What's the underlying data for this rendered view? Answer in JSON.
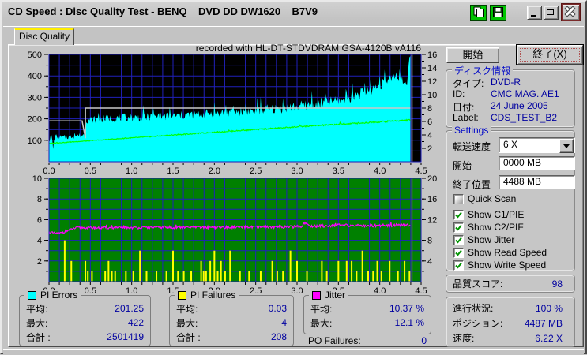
{
  "window": {
    "title": "CD Speed : Disc Quality Test - BENQ    DVD DD DW1620    B7V9"
  },
  "tab": {
    "label": "Disc Quality"
  },
  "chart_data": [
    {
      "type": "area",
      "title": "recorded with HL-DT-STDVDRAM GSA-4120B vA116",
      "x_axis": {
        "min": 0,
        "max": 4.5,
        "minor_step": 0.125,
        "ticks": [
          [
            0,
            "0.0"
          ],
          [
            0.5,
            "0.5"
          ],
          [
            1,
            "1.0"
          ],
          [
            1.5,
            "1.5"
          ],
          [
            2,
            "2.0"
          ],
          [
            2.5,
            "2.5"
          ],
          [
            3,
            "3.0"
          ],
          [
            3.5,
            "3.5"
          ],
          [
            4,
            "4.0"
          ],
          [
            4.5,
            "4.5"
          ]
        ]
      },
      "y_left": {
        "min": 0,
        "max": 500,
        "grid_step": 50,
        "ticks": [
          [
            500,
            "500"
          ],
          [
            400,
            "400"
          ],
          [
            300,
            "300"
          ],
          [
            200,
            "200"
          ],
          [
            100,
            "100"
          ]
        ]
      },
      "y_right": {
        "min": 0,
        "max": 16,
        "minor_step": 1,
        "ticks": [
          [
            16,
            "16"
          ],
          [
            14,
            "14"
          ],
          [
            12,
            "12"
          ],
          [
            10,
            "10"
          ],
          [
            8,
            "8"
          ],
          [
            6,
            "6"
          ],
          [
            4,
            "4"
          ],
          [
            2,
            "2"
          ]
        ]
      },
      "bg": "#000000",
      "grid_color": "#2121bb",
      "border_color": "#1a1ab8",
      "data_end_x": 4.37,
      "end_line_color": "#c0c0c0",
      "series": [
        {
          "name": "PI Errors",
          "type": "noisy_area",
          "color": "#00ffff",
          "axis": "left",
          "seed": 7,
          "trend": [
            [
              0,
              95
            ],
            [
              0.03,
              120
            ],
            [
              0.05,
              60
            ],
            [
              0.07,
              115
            ],
            [
              0.15,
              110
            ],
            [
              0.25,
              112
            ],
            [
              0.35,
              118
            ],
            [
              0.43,
              122
            ],
            [
              0.45,
              190
            ],
            [
              0.55,
              192
            ],
            [
              0.7,
              196
            ],
            [
              0.9,
              200
            ],
            [
              1.1,
              200
            ],
            [
              1.3,
              203
            ],
            [
              1.5,
              206
            ],
            [
              1.7,
              212
            ],
            [
              1.9,
              218
            ],
            [
              2.1,
              222
            ],
            [
              2.3,
              228
            ],
            [
              2.5,
              232
            ],
            [
              2.7,
              238
            ],
            [
              2.9,
              244
            ],
            [
              3.05,
              252
            ],
            [
              3.2,
              262
            ],
            [
              3.35,
              268
            ],
            [
              3.5,
              278
            ],
            [
              3.6,
              290
            ],
            [
              3.7,
              302
            ],
            [
              3.8,
              312
            ],
            [
              3.9,
              330
            ],
            [
              4.0,
              345
            ],
            [
              4.08,
              362
            ],
            [
              4.15,
              378
            ],
            [
              4.2,
              380
            ],
            [
              4.25,
              385
            ],
            [
              4.3,
              360
            ],
            [
              4.33,
              345
            ],
            [
              4.35,
              460
            ],
            [
              4.37,
              495
            ]
          ],
          "noise": [
            [
              0,
              22
            ],
            [
              0.44,
              25
            ],
            [
              0.46,
              35
            ],
            [
              1.0,
              40
            ],
            [
              2.0,
              45
            ],
            [
              3.0,
              50
            ],
            [
              3.6,
              55
            ],
            [
              4.0,
              55
            ],
            [
              4.2,
              45
            ],
            [
              4.37,
              18
            ]
          ]
        },
        {
          "name": "Write Speed",
          "type": "line",
          "color": "#c9c9c9",
          "axis": "right",
          "points": [
            [
              0,
              6.1
            ],
            [
              0.4,
              6.1
            ],
            [
              0.44,
              3.5
            ],
            [
              0.44,
              8.0
            ],
            [
              4.37,
              8.0
            ]
          ]
        },
        {
          "name": "Read Speed",
          "type": "noisy_line",
          "color": "#00ff00",
          "axis": "right",
          "seed": 3,
          "trend": [
            [
              0,
              2.72
            ],
            [
              1,
              3.55
            ],
            [
              2,
              4.4
            ],
            [
              3,
              5.2
            ],
            [
              4,
              5.95
            ],
            [
              4.37,
              6.22
            ]
          ],
          "noise": [
            [
              0,
              0.05
            ],
            [
              3,
              0.09
            ],
            [
              4.37,
              0.13
            ]
          ]
        }
      ]
    },
    {
      "type": "mixed",
      "title": "",
      "x_axis": {
        "min": 0,
        "max": 4.5,
        "minor_step": 0.125,
        "ticks": [
          [
            0,
            "0.0"
          ],
          [
            0.5,
            "0.5"
          ],
          [
            1,
            "1.0"
          ],
          [
            1.5,
            "1.5"
          ],
          [
            2,
            "2.0"
          ],
          [
            2.5,
            "2.5"
          ],
          [
            3,
            "3.0"
          ],
          [
            3.5,
            "3.5"
          ],
          [
            4,
            "4.0"
          ],
          [
            4.5,
            "4.5"
          ]
        ]
      },
      "y_left": {
        "min": 0,
        "max": 10,
        "grid_step": 1,
        "ticks": [
          [
            10,
            "10"
          ],
          [
            8,
            "8"
          ],
          [
            6,
            "6"
          ],
          [
            4,
            "4"
          ],
          [
            2,
            "2"
          ]
        ]
      },
      "y_right": {
        "min": 0,
        "max": 20,
        "minor_step": 2,
        "ticks": [
          [
            20,
            "20"
          ],
          [
            16,
            "16"
          ],
          [
            12,
            "12"
          ],
          [
            8,
            "8"
          ],
          [
            4,
            "4"
          ]
        ]
      },
      "bg": "#008000",
      "grid_color": "#2121bb",
      "border_color": "#1a1ab8",
      "data_end_x": 4.37,
      "end_line_color": "#6a6a6a",
      "series": [
        {
          "name": "PI Failures",
          "type": "bars",
          "color": "#ffff00",
          "axis": "left",
          "points": [
            [
              0.19,
              4
            ],
            [
              0.27,
              2
            ],
            [
              0.44,
              2
            ],
            [
              0.47,
              1
            ],
            [
              0.52,
              1
            ],
            [
              0.68,
              1
            ],
            [
              0.72,
              2
            ],
            [
              0.76,
              1
            ],
            [
              0.8,
              1
            ],
            [
              0.93,
              1
            ],
            [
              1.02,
              1
            ],
            [
              1.1,
              3
            ],
            [
              1.18,
              1
            ],
            [
              1.3,
              1
            ],
            [
              1.42,
              1
            ],
            [
              1.5,
              3
            ],
            [
              1.56,
              1
            ],
            [
              1.63,
              1
            ],
            [
              1.72,
              1
            ],
            [
              1.84,
              2
            ],
            [
              1.87,
              1
            ],
            [
              1.9,
              1
            ],
            [
              1.95,
              2
            ],
            [
              2.0,
              3
            ],
            [
              2.04,
              1
            ],
            [
              2.08,
              2
            ],
            [
              2.13,
              1
            ],
            [
              2.19,
              3
            ],
            [
              2.31,
              1
            ],
            [
              2.42,
              1
            ],
            [
              2.56,
              1
            ],
            [
              2.7,
              2
            ],
            [
              2.76,
              1
            ],
            [
              2.83,
              1
            ],
            [
              2.92,
              3
            ],
            [
              3.0,
              2
            ],
            [
              3.12,
              1
            ],
            [
              3.3,
              2
            ],
            [
              3.36,
              1
            ],
            [
              3.5,
              2
            ],
            [
              3.6,
              2
            ],
            [
              3.66,
              2
            ],
            [
              3.72,
              1
            ],
            [
              3.79,
              3
            ],
            [
              3.86,
              1
            ],
            [
              3.92,
              1
            ],
            [
              3.97,
              2
            ],
            [
              4.02,
              1
            ],
            [
              4.12,
              2
            ],
            [
              4.22,
              1
            ],
            [
              4.3,
              2
            ],
            [
              4.36,
              1
            ]
          ]
        },
        {
          "name": "Jitter",
          "type": "noisy_line",
          "color": "#ff00ff",
          "axis": "right",
          "seed": 11,
          "trend": [
            [
              0,
              9.6
            ],
            [
              0.05,
              9.4
            ],
            [
              0.12,
              9.3
            ],
            [
              0.2,
              9.7
            ],
            [
              0.28,
              10.2
            ],
            [
              0.35,
              10.45
            ],
            [
              0.6,
              10.4
            ],
            [
              1.0,
              10.45
            ],
            [
              1.5,
              10.5
            ],
            [
              2.0,
              10.5
            ],
            [
              2.5,
              10.55
            ],
            [
              2.9,
              10.6
            ],
            [
              3.05,
              10.65
            ],
            [
              3.1,
              11.5
            ],
            [
              3.15,
              10.7
            ],
            [
              3.5,
              10.9
            ],
            [
              3.9,
              10.85
            ],
            [
              4.2,
              10.95
            ],
            [
              4.37,
              10.9
            ]
          ],
          "noise": [
            [
              0,
              0.22
            ],
            [
              4.37,
              0.3
            ]
          ]
        }
      ]
    }
  ],
  "stats": {
    "pi_errors": {
      "legend": "PI Errors",
      "color": "#00ffff",
      "rows": [
        [
          "平均:",
          "201.25"
        ],
        [
          "最大:",
          "422"
        ],
        [
          "合計 :",
          "2501419"
        ]
      ]
    },
    "pi_failures": {
      "legend": "PI Failures",
      "color": "#ffff00",
      "rows": [
        [
          "平均:",
          "0.03"
        ],
        [
          "最大:",
          "4"
        ],
        [
          "合計 :",
          "208"
        ]
      ]
    },
    "jitter": {
      "legend": "Jitter",
      "color": "#ff00ff",
      "rows": [
        [
          "平均:",
          "10.37 %"
        ],
        [
          "最大:",
          "12.1 %"
        ]
      ]
    },
    "po_failures": {
      "label": "PO Failures:",
      "value": "0"
    }
  },
  "panel": {
    "start_button": "開始",
    "exit_button": "終了(X)",
    "disc_info": {
      "caption": "ディスク情報",
      "rows": [
        [
          "タイプ:",
          "DVD-R"
        ],
        [
          "ID:",
          "CMC MAG. AE1"
        ],
        [
          "日付:",
          "24 June 2005"
        ],
        [
          "Label:",
          "CDS_TEST_B2"
        ]
      ]
    },
    "settings": {
      "caption": "Settings",
      "speed_label": "転送速度",
      "speed_value": "6 X",
      "start_label": "開始",
      "start_value": "0000 MB",
      "end_label": "終了位置",
      "end_value": "4488 MB",
      "checkboxes": [
        {
          "label": "Quick Scan",
          "checked": false,
          "disabled": true
        },
        {
          "label": "Show C1/PIE",
          "checked": true
        },
        {
          "label": "Show C2/PIF",
          "checked": true
        },
        {
          "label": "Show Jitter",
          "checked": true
        },
        {
          "label": "Show Read Speed",
          "checked": true
        },
        {
          "label": "Show Write Speed",
          "checked": true
        }
      ]
    },
    "quality": {
      "label": "品質スコア:",
      "value": "98"
    },
    "progress": {
      "rows": [
        [
          "進行状況:",
          "100 %"
        ],
        [
          "ポジション:",
          "4487 MB"
        ],
        [
          "速度:",
          "6.22 X"
        ]
      ]
    }
  }
}
